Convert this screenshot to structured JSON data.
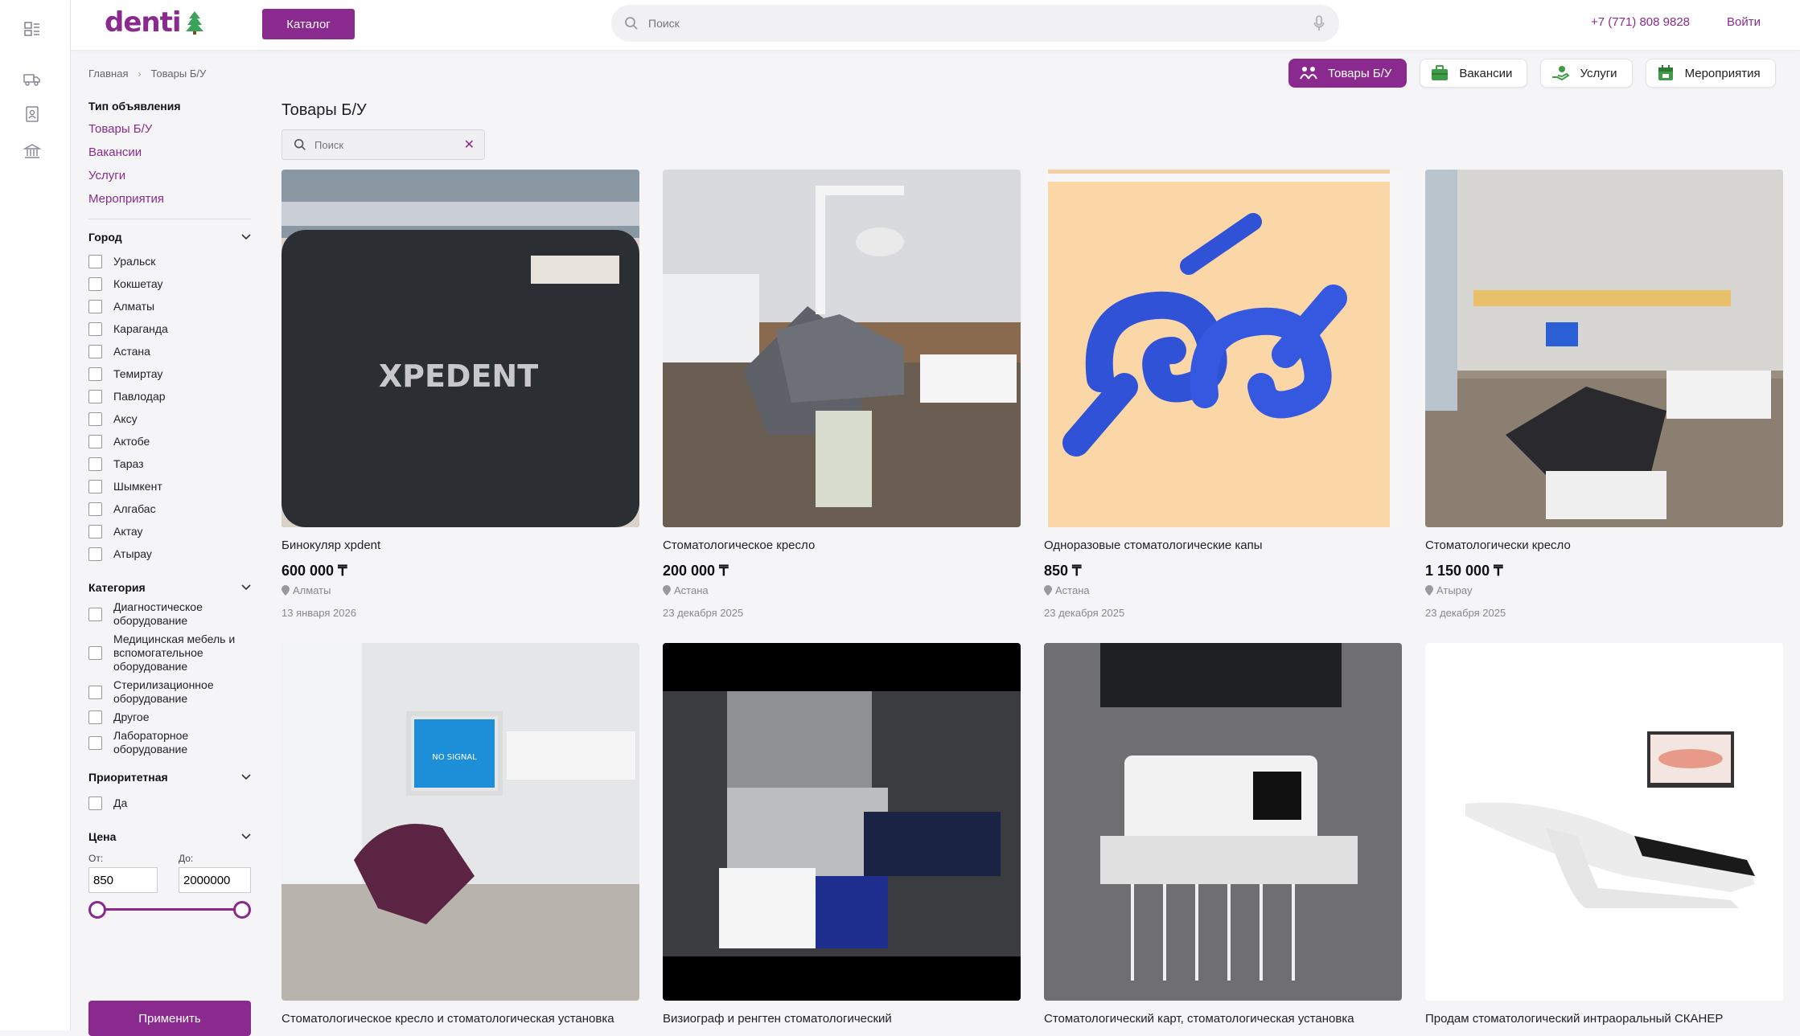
{
  "brand": {
    "logo_text": "denti",
    "accent": "#8a2a8f"
  },
  "header": {
    "catalog_label": "Каталог",
    "search_placeholder": "Поиск",
    "phone": "+7 (771) 808 9828",
    "login_label": "Войти"
  },
  "rail": {
    "icons": [
      "list-icon",
      "truck-icon",
      "contacts-icon",
      "bank-icon"
    ]
  },
  "breadcrumb": {
    "home": "Главная",
    "current": "Товары Б/У"
  },
  "pills": [
    {
      "label": "Товары Б/У",
      "icon": "people-icon",
      "active": true
    },
    {
      "label": "Вакансии",
      "icon": "briefcase-icon",
      "active": false
    },
    {
      "label": "Услуги",
      "icon": "hand-icon",
      "active": false
    },
    {
      "label": "Мероприятия",
      "icon": "calendar-icon",
      "active": false
    }
  ],
  "filters": {
    "type_header": "Тип объявления",
    "types": [
      "Товары Б/У",
      "Вакансии",
      "Услуги",
      "Мероприятия"
    ],
    "city_header": "Город",
    "cities": [
      "Уральск",
      "Кокшетау",
      "Алматы",
      "Караганда",
      "Астана",
      "Темиртау",
      "Павлодар",
      "Аксу",
      "Актобе",
      "Тараз",
      "Шымкент",
      "Алгабас",
      "Актау",
      "Атырау"
    ],
    "category_header": "Категория",
    "categories": [
      "Диагностическое оборудование",
      "Медицинская мебель и вспомогательное оборудование",
      "Стерилизационное оборудование",
      "Другое",
      "Лабораторное оборудование"
    ],
    "priority_header": "Приоритетная",
    "priority_option": "Да",
    "price_header": "Цена",
    "from_label": "От:",
    "to_label": "До:",
    "price_from": "850",
    "price_to": "2000000",
    "apply_label": "Применить"
  },
  "main": {
    "title": "Товары Б/У",
    "search_placeholder": "Поиск"
  },
  "listings": [
    {
      "title": "Бинокуляр xpdent",
      "price": "600 000 ₸",
      "city": "Алматы",
      "date": "13 января 2026"
    },
    {
      "title": "Стоматологическое кресло",
      "price": "200 000 ₸",
      "city": "Астана",
      "date": "23 декабря 2025"
    },
    {
      "title": "Одноразовые стоматологические капы",
      "price": "850 ₸",
      "city": "Астана",
      "date": "23 декабря 2025"
    },
    {
      "title": "Стоматологически кресло",
      "price": "1 150 000 ₸",
      "city": "Атырау",
      "date": "23 декабря 2025"
    },
    {
      "title": "Стоматологическое кресло и стоматологическая установка",
      "price": "",
      "city": "",
      "date": ""
    },
    {
      "title": "Визиограф и ренгтен стоматологический",
      "price": "",
      "city": "",
      "date": ""
    },
    {
      "title": "Стоматологический карт, стоматологическая установка",
      "price": "",
      "city": "",
      "date": ""
    },
    {
      "title": "Продам стоматологический интраоральный СКАНЕР",
      "price": "",
      "city": "",
      "date": ""
    }
  ],
  "image_texts": {
    "case_brand": "XPEDENT",
    "monitor_text": "NO SIGNAL"
  }
}
